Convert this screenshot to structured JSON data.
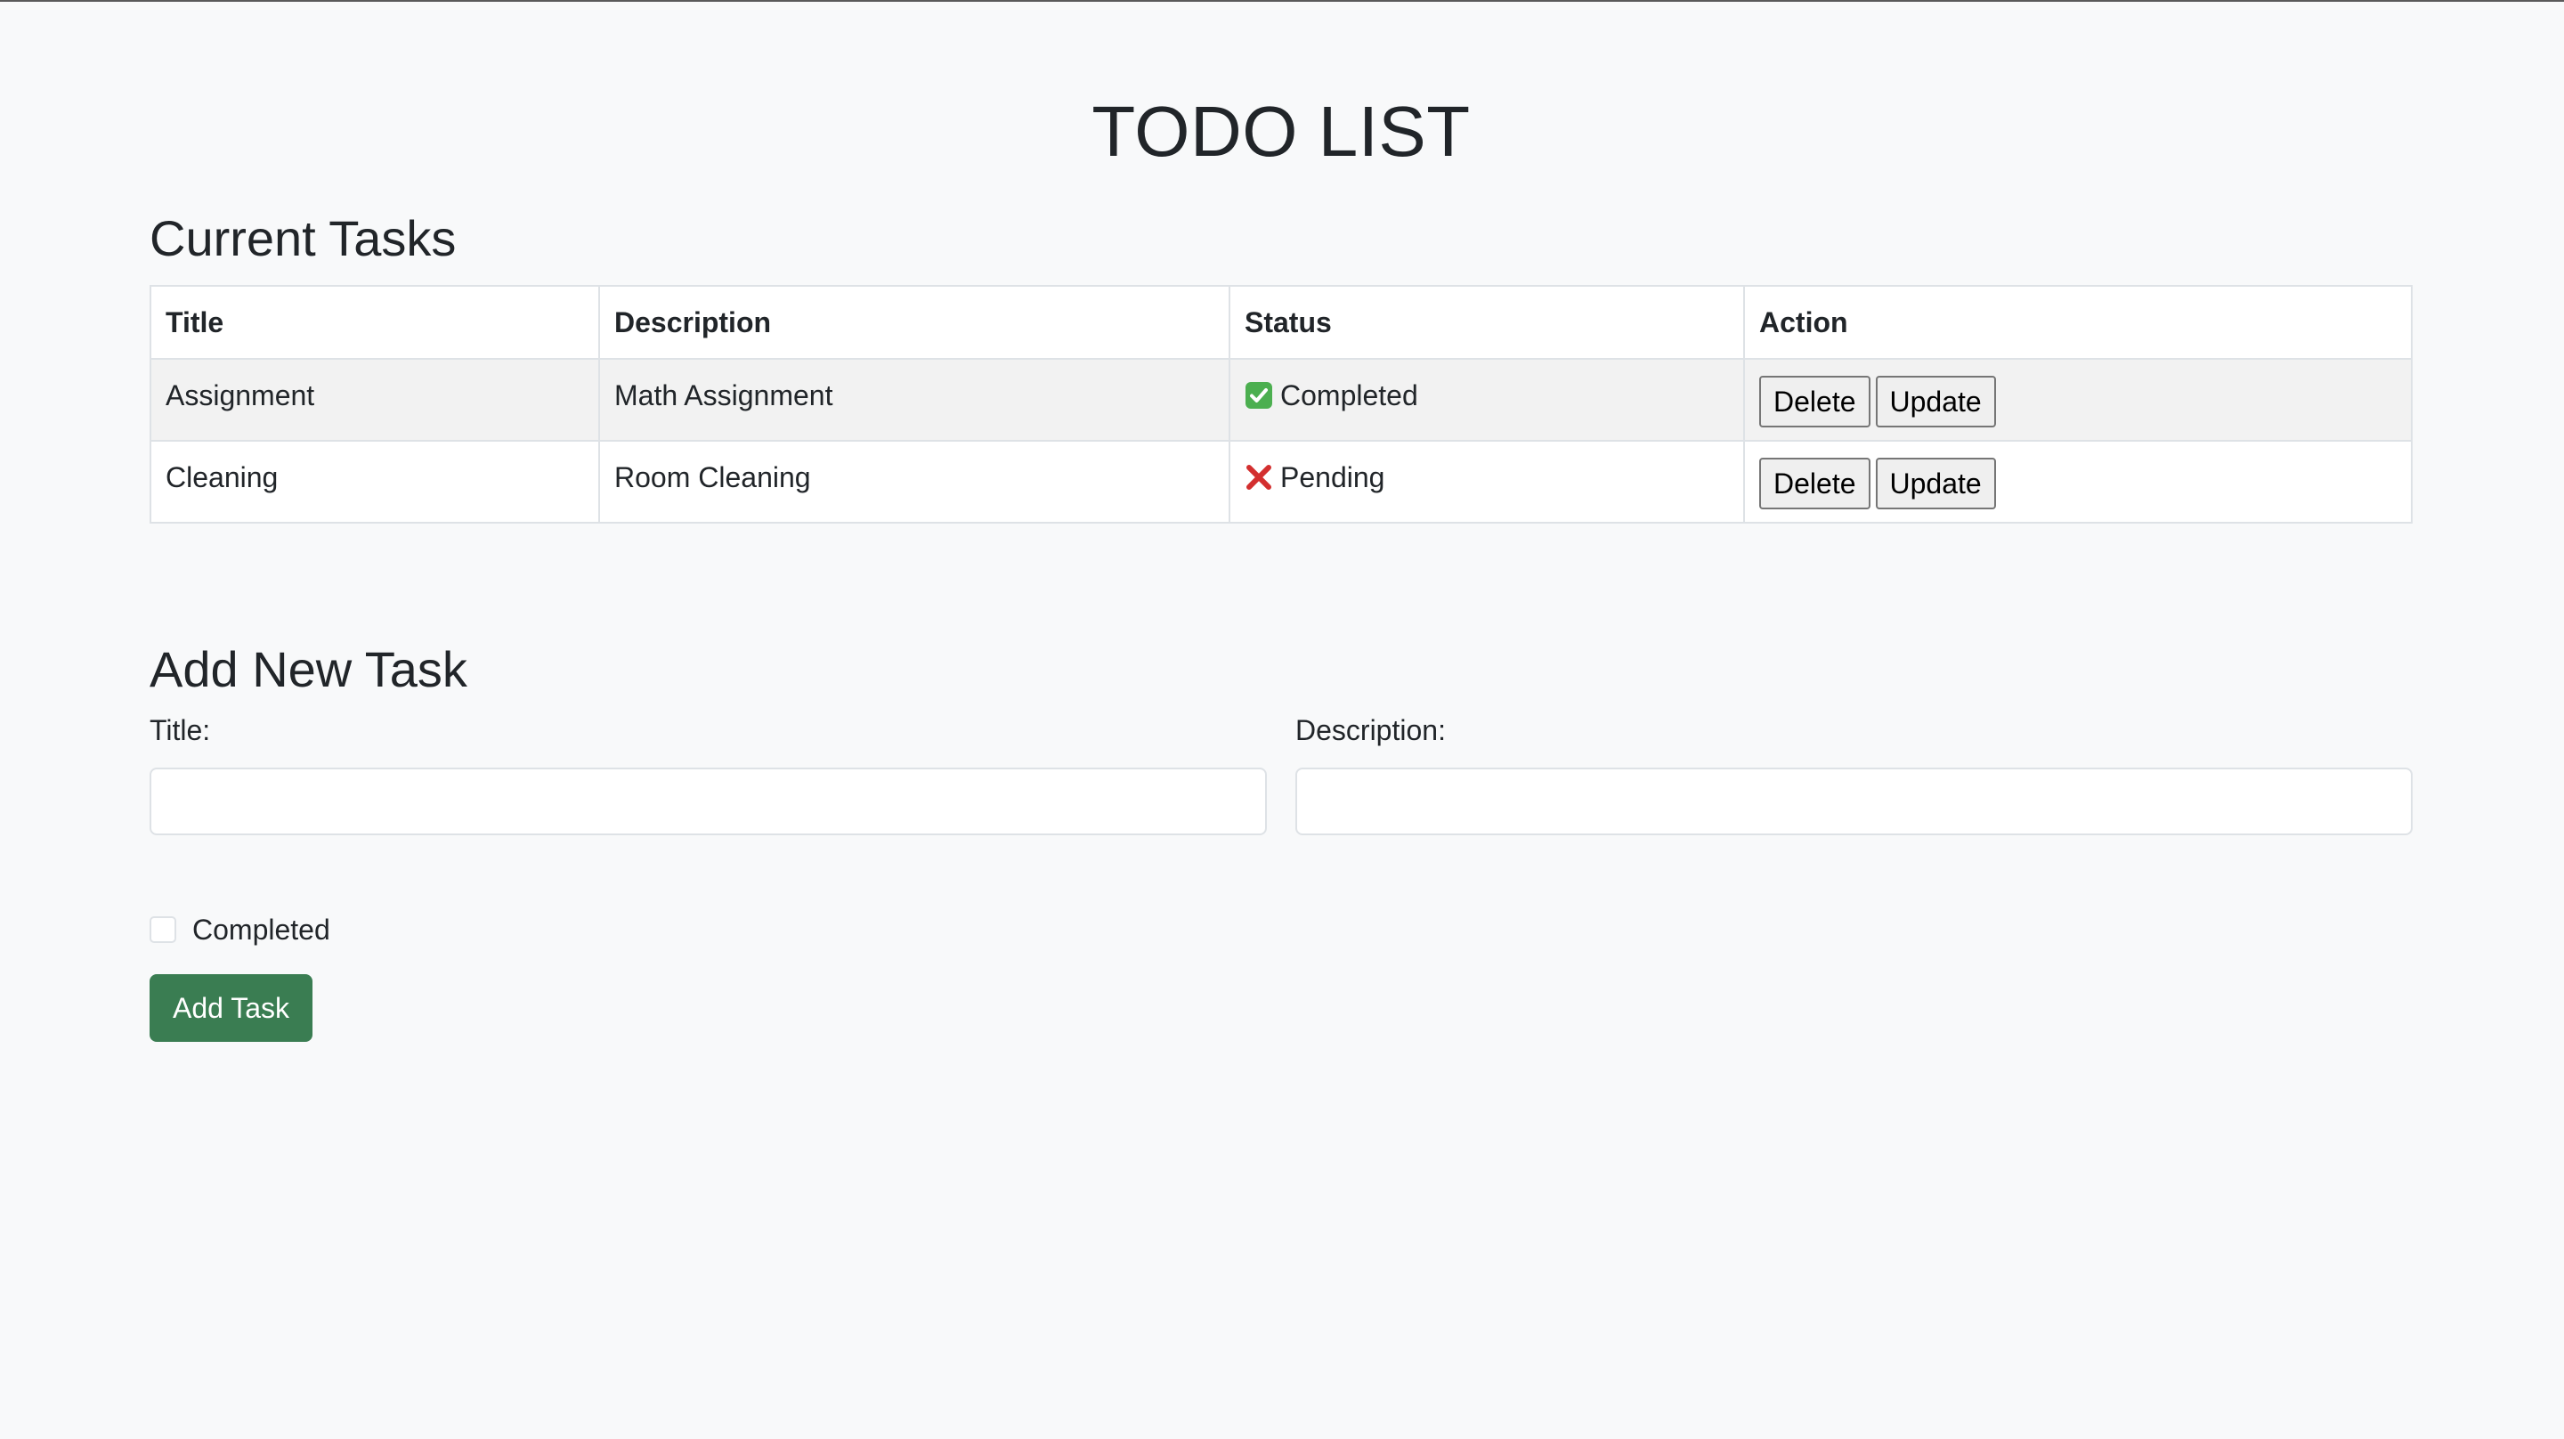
{
  "page": {
    "title": "TODO LIST"
  },
  "current_tasks": {
    "heading": "Current Tasks",
    "columns": {
      "title": "Title",
      "description": "Description",
      "status": "Status",
      "action": "Action"
    },
    "rows": [
      {
        "title": "Assignment",
        "description": "Math Assignment",
        "status_icon": "check-mark-icon",
        "status": "Completed",
        "delete_label": "Delete",
        "update_label": "Update"
      },
      {
        "title": "Cleaning",
        "description": "Room Cleaning",
        "status_icon": "cross-mark-icon",
        "status": "Pending",
        "delete_label": "Delete",
        "update_label": "Update"
      }
    ]
  },
  "add_task": {
    "heading": "Add New Task",
    "title_label": "Title:",
    "title_value": "",
    "description_label": "Description:",
    "description_value": "",
    "completed_label": "Completed",
    "completed_checked": false,
    "submit_label": "Add Task"
  },
  "colors": {
    "page_background": "#f8f9fa",
    "primary_button": "#3a7d52",
    "completed_icon": "#4caf50",
    "pending_icon": "#d32f2f"
  }
}
